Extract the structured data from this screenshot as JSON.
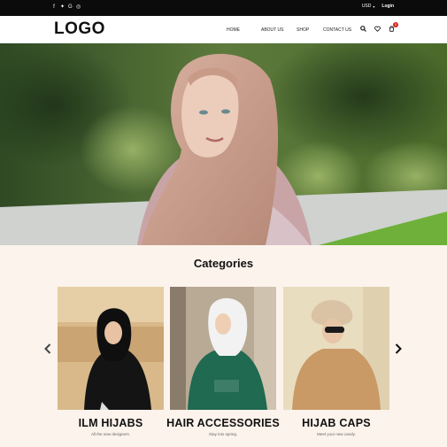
{
  "topbar": {
    "social": [
      {
        "icon": "facebook-icon",
        "glyph": "f"
      },
      {
        "icon": "twitter-icon",
        "glyph": "✦"
      },
      {
        "icon": "google-icon",
        "glyph": "G"
      },
      {
        "icon": "instagram-icon",
        "glyph": "◎"
      }
    ],
    "currency": "USD",
    "login": "Login"
  },
  "header": {
    "logo": "LOGO",
    "nav": [
      "HOME",
      "ABOUT US",
      "SHOP",
      "CONTACT US"
    ],
    "cart_count": "0"
  },
  "categories": {
    "title": "Categories",
    "items": [
      {
        "name": "ILM HIJABS",
        "subtitle": "All the new designers."
      },
      {
        "name": "HAIR ACCESSORIES",
        "subtitle": "Stay into spring."
      },
      {
        "name": "HIJAB CAPS",
        "subtitle": "Meet your new candy."
      }
    ]
  },
  "colors": {
    "topbar": "#0b0b0b",
    "page_bg": "#fcf3ec",
    "cart_badge": "#d9261c"
  }
}
